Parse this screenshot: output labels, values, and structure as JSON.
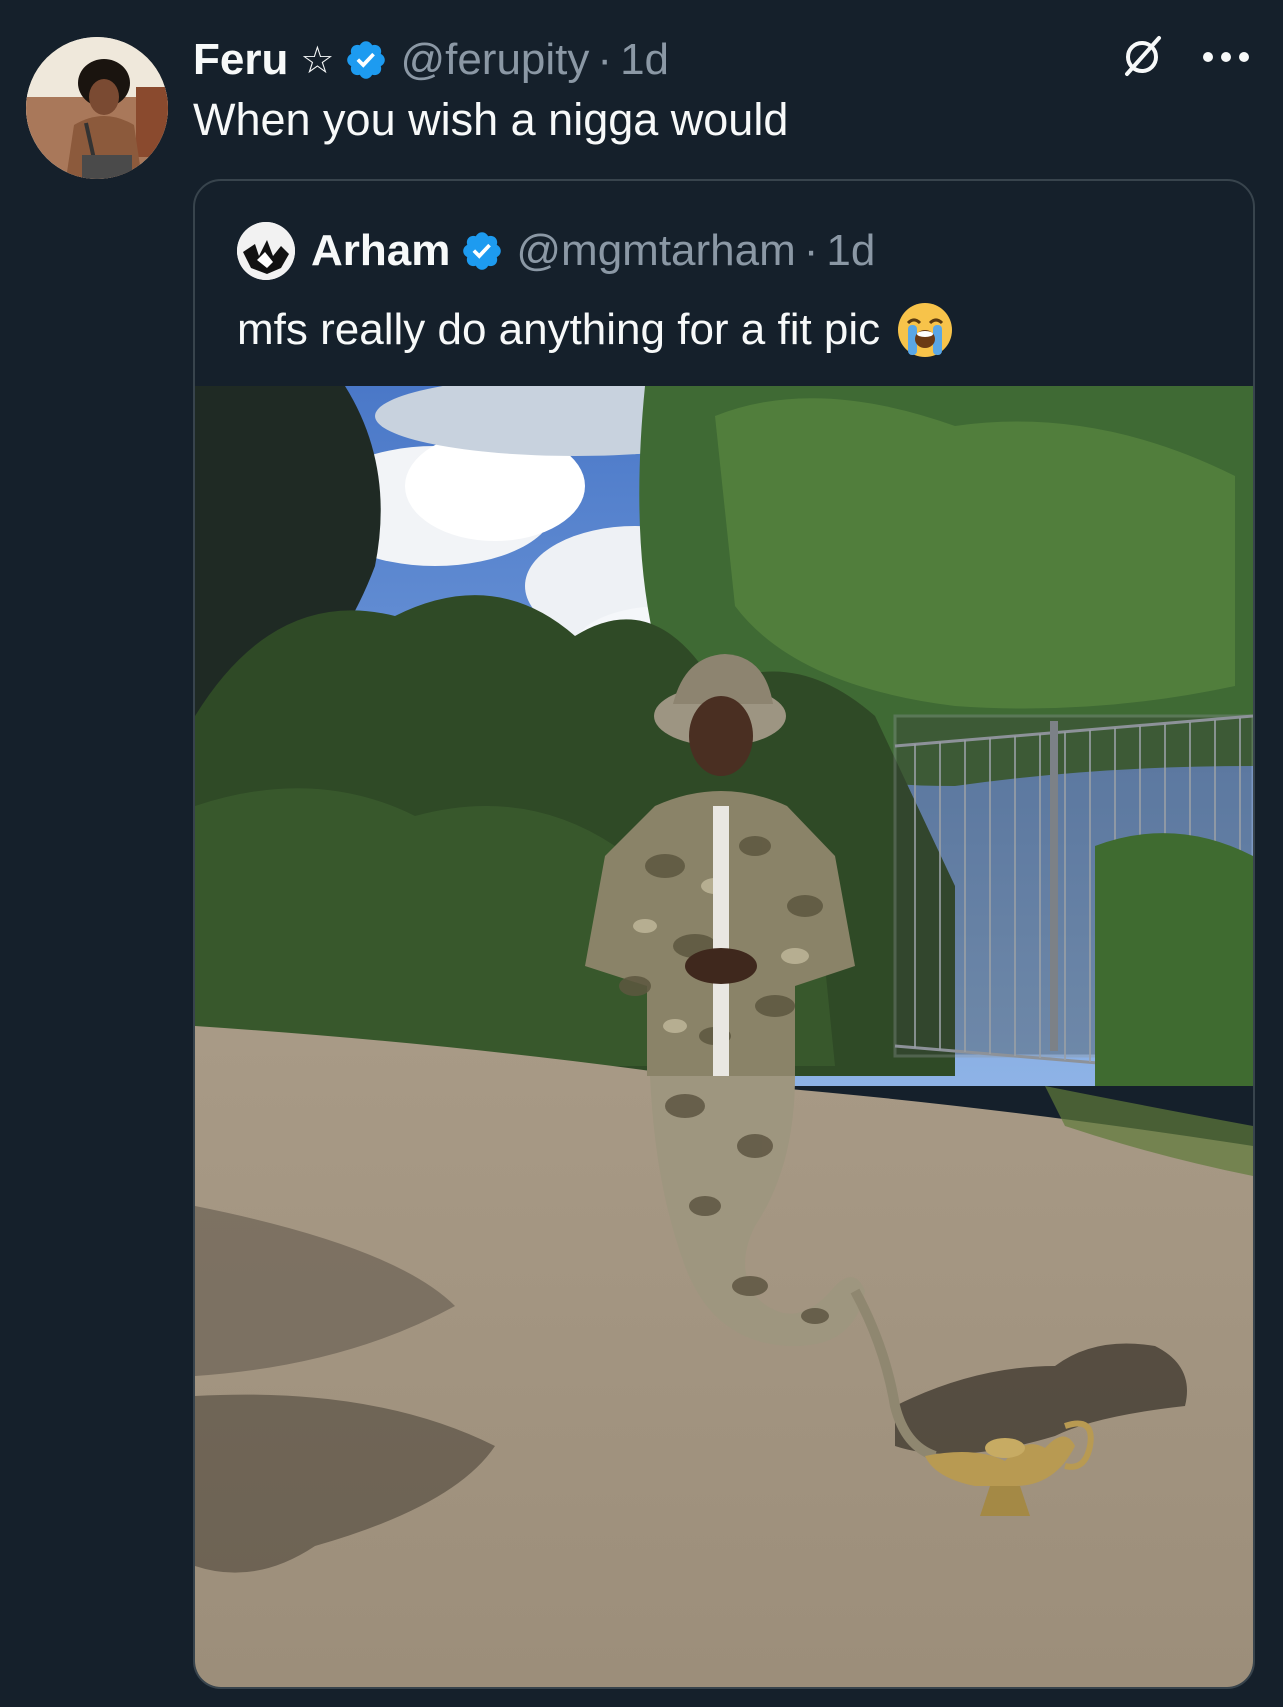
{
  "tweet": {
    "display_name": "Feru",
    "star_glyph": "☆",
    "handle": "@ferupity",
    "separator": "·",
    "timestamp": "1d",
    "text": "When you wish a nigga would",
    "icons": {
      "avatar": "avatar",
      "verified": "verified-badge-icon",
      "grok": "grok-icon",
      "more": "more-options-icon"
    },
    "colors": {
      "background": "#15202b",
      "text": "#f7f9f9",
      "muted": "#8b98a5",
      "verified": "#1d9bf0",
      "border": "#38444d"
    }
  },
  "quoted_tweet": {
    "display_name": "Arham",
    "handle": "@mgmtarham",
    "separator": "·",
    "timestamp": "1d",
    "text": "mfs really do anything for a fit pic",
    "emoji": "loudly-crying-face",
    "media": "photo-genie-camo-outfit-lamp"
  }
}
